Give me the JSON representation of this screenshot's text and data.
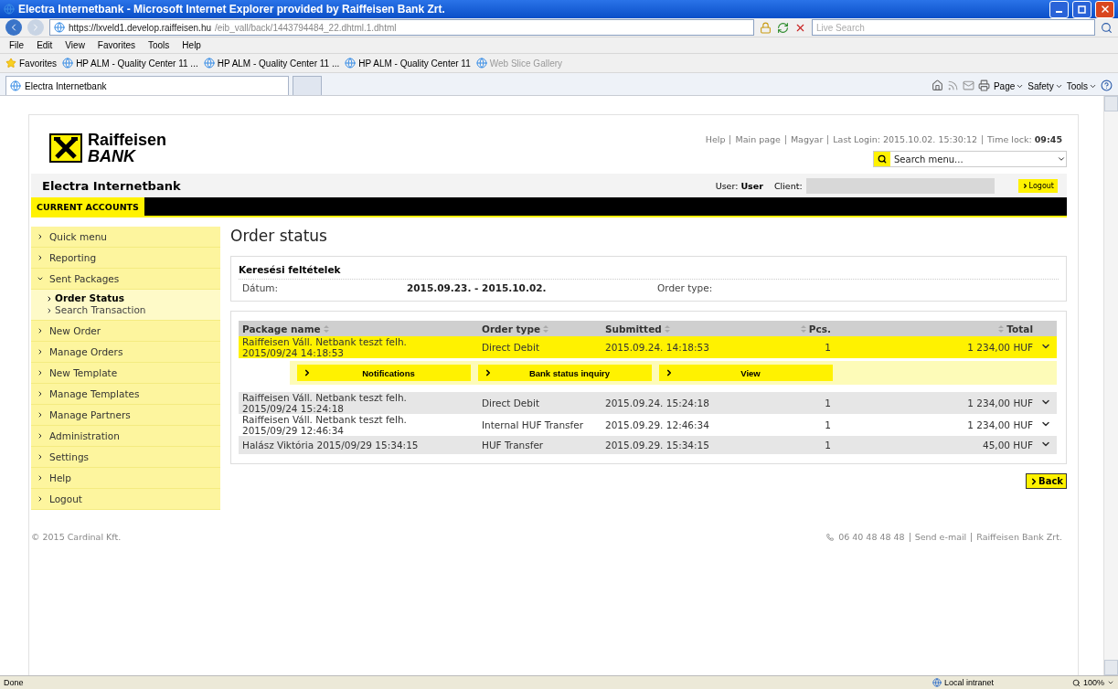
{
  "browser": {
    "title": "Electra Internetbank - Microsoft Internet Explorer provided by Raiffeisen Bank Zrt.",
    "address": {
      "host": "https://lxveld1.develop.raiffeisen.hu",
      "path": "/eib_vall/back/1443794484_22.dhtml.1.dhtml"
    },
    "search_placeholder": "Live Search",
    "menu": [
      "File",
      "Edit",
      "View",
      "Favorites",
      "Tools",
      "Help"
    ],
    "favorites_label": "Favorites",
    "favorites": [
      {
        "label": "HP ALM - Quality Center 11 ...",
        "disabled": false
      },
      {
        "label": "HP ALM - Quality Center 11 ...",
        "disabled": false
      },
      {
        "label": "HP ALM - Quality Center 11",
        "disabled": false
      },
      {
        "label": "Web Slice Gallery",
        "disabled": true
      }
    ],
    "tab": "Electra Internetbank",
    "commands": [
      "Page",
      "Safety",
      "Tools"
    ],
    "status": {
      "text": "Done",
      "zone": "Local intranet",
      "zoom": "100%"
    }
  },
  "header": {
    "brand": [
      "Raiffeisen",
      "BANK"
    ],
    "links": [
      "Help",
      "Main page",
      "Magyar",
      "Last Login: 2015.10.02. 15:30:12",
      "Time lock: **09:45**"
    ],
    "search_placeholder": "Search menu...",
    "app_title": "Electra Internetbank",
    "user": "User: **User**",
    "client_label": "Client:",
    "logout": "Logout"
  },
  "nav_tabs": [
    {
      "label": "CURRENT ACCOUNTS",
      "selected": true
    }
  ],
  "sidebar": [
    {
      "label": "Quick menu",
      "expanded": false
    },
    {
      "label": "Reporting",
      "expanded": false
    },
    {
      "label": "Sent Packages",
      "expanded": true,
      "children": [
        {
          "label": "Order Status",
          "selected": true
        },
        {
          "label": "Search Transaction",
          "selected": false
        }
      ]
    },
    {
      "label": "New Order",
      "expanded": false
    },
    {
      "label": "Manage Orders",
      "expanded": false
    },
    {
      "label": "New Template",
      "expanded": false
    },
    {
      "label": "Manage Templates",
      "expanded": false
    },
    {
      "label": "Manage Partners",
      "expanded": false
    },
    {
      "label": "Administration",
      "expanded": false
    },
    {
      "label": "Settings",
      "expanded": false
    },
    {
      "label": "Help",
      "expanded": false
    },
    {
      "label": "Logout",
      "expanded": false
    }
  ],
  "page_title": "Order status",
  "criteria": {
    "title": "Keresési feltételek",
    "fields": [
      {
        "label": "Dátum:",
        "value": "2015.09.23. - 2015.10.02."
      },
      {
        "label": "Order type:"
      }
    ]
  },
  "table": {
    "columns": [
      "Package name",
      "Order type",
      "Submitted",
      "Pcs.",
      "Total"
    ],
    "rows": [
      {
        "package": "Raiffeisen Váll. Netbank teszt felh. 2015/09/24 14:18:53",
        "order_type": "Direct Debit",
        "submitted": "2015.09.24. 14:18:53",
        "pcs": "1",
        "total": "1 234,00 HUF",
        "selected": true,
        "actions": [
          "Notifications",
          "Bank status inquiry",
          "View"
        ]
      },
      {
        "package": "Raiffeisen Váll. Netbank teszt felh. 2015/09/24 15:24:18",
        "order_type": "Direct Debit",
        "submitted": "2015.09.24. 15:24:18",
        "pcs": "1",
        "total": "1 234,00 HUF",
        "selected": false
      },
      {
        "package": "Raiffeisen Váll. Netbank teszt felh. 2015/09/29 12:46:34",
        "order_type": "Internal HUF Transfer",
        "submitted": "2015.09.29. 12:46:34",
        "pcs": "1",
        "total": "1 234,00 HUF",
        "selected": false
      },
      {
        "package": "Halász Viktória 2015/09/29 15:34:15",
        "order_type": "HUF Transfer",
        "submitted": "2015.09.29. 15:34:15",
        "pcs": "1",
        "total": "45,00 HUF",
        "selected": false
      }
    ]
  },
  "back": "Back",
  "footer": {
    "copyright": "© 2015 Cardinal Kft.",
    "phone": "06 40 48 48 48",
    "links": [
      "Send e-mail",
      "Raiffeisen Bank Zrt."
    ]
  }
}
